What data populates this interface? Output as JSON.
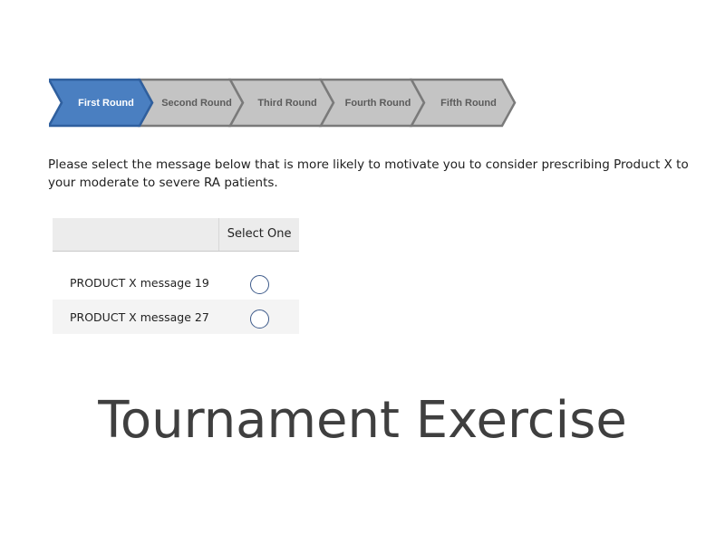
{
  "stepper": {
    "steps": [
      {
        "label": "First Round",
        "active": true
      },
      {
        "label": "Second Round",
        "active": false
      },
      {
        "label": "Third Round",
        "active": false
      },
      {
        "label": "Fourth Round",
        "active": false
      },
      {
        "label": "Fifth Round",
        "active": false
      }
    ],
    "active_color": "#4a7fc1",
    "inactive_color": "#c4c4c4",
    "border_color": "#7a7a7a"
  },
  "question": "Please select the message below that is more likely to motivate you to consider prescribing Product X to your moderate to severe RA patients.",
  "table": {
    "column_header": "Select One",
    "rows": [
      {
        "label": "PRODUCT X message 19",
        "selected": false
      },
      {
        "label": "PRODUCT X message 27",
        "selected": false
      }
    ]
  },
  "title": "Tournament Exercise"
}
